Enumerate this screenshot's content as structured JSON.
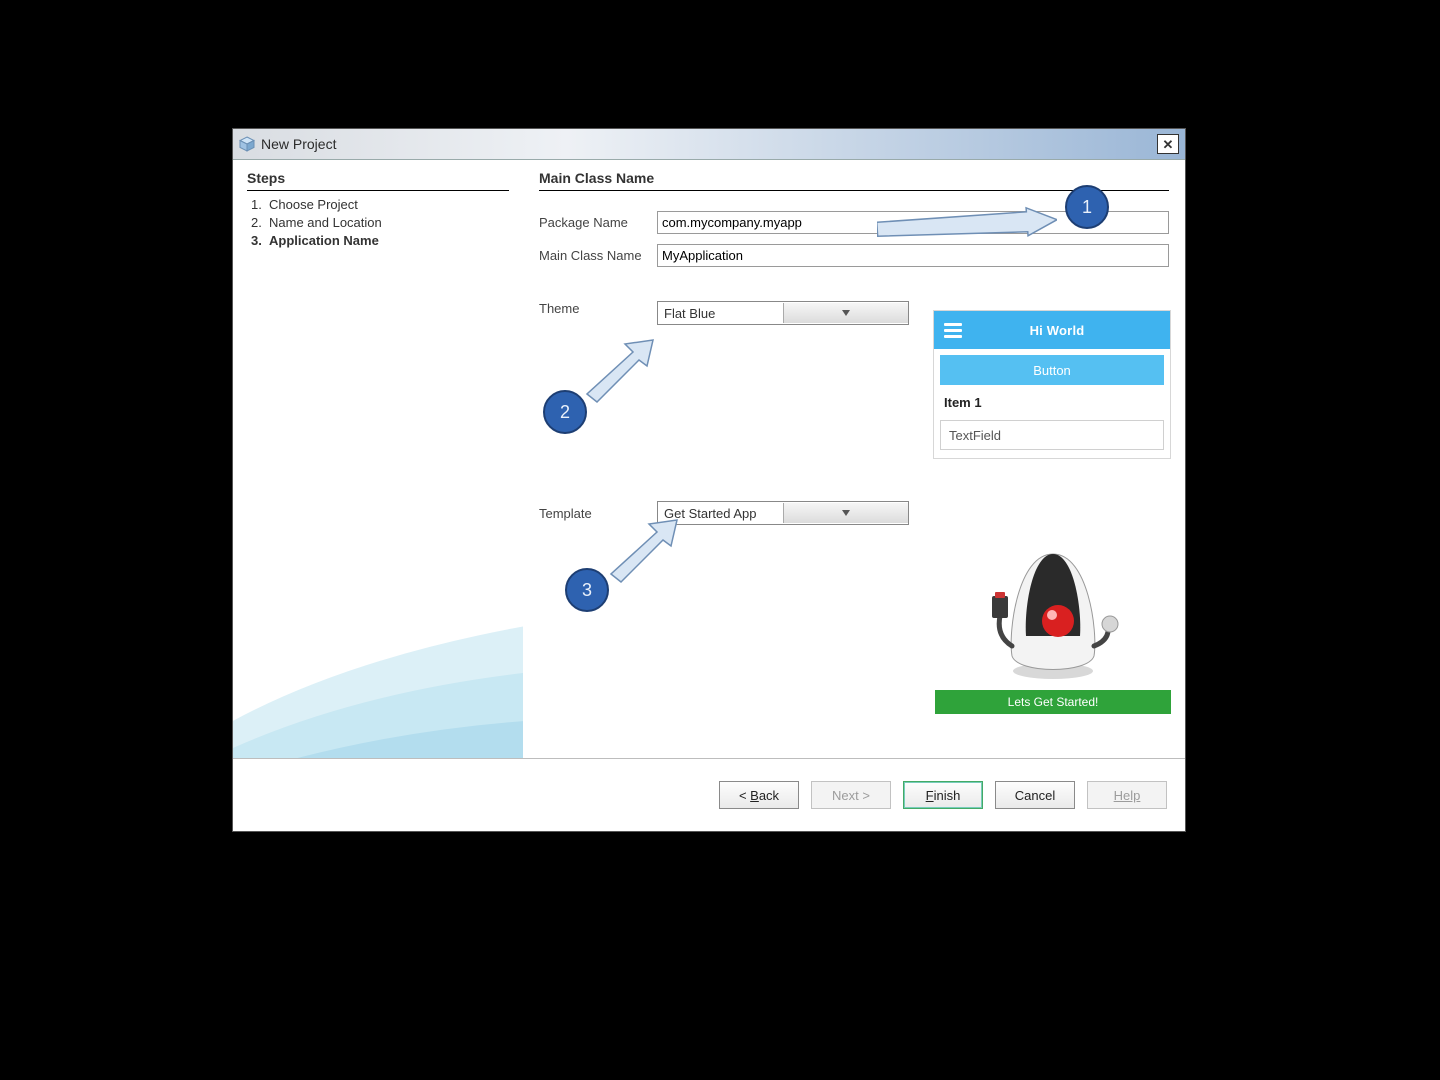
{
  "titlebar": {
    "title": "New Project"
  },
  "sidebar": {
    "heading": "Steps",
    "steps": [
      {
        "num": "1.",
        "label": "Choose Project",
        "active": false
      },
      {
        "num": "2.",
        "label": "Name and Location",
        "active": false
      },
      {
        "num": "3.",
        "label": "Application Name",
        "active": true
      }
    ]
  },
  "main": {
    "heading": "Main Class Name",
    "package_label": "Package Name",
    "package_value": "com.mycompany.myapp",
    "class_label": "Main Class Name",
    "class_value": "MyApplication",
    "theme_label": "Theme",
    "theme_value": "Flat Blue",
    "template_label": "Template",
    "template_value": "Get Started App"
  },
  "theme_preview": {
    "title": "Hi World",
    "button": "Button",
    "item": "Item 1",
    "textfield": "TextField"
  },
  "template_preview": {
    "cta": "Lets Get Started!"
  },
  "footer": {
    "back": "< Back",
    "next": "Next >",
    "finish": "Finish",
    "cancel": "Cancel",
    "help": "Help"
  },
  "callouts": {
    "c1": "1",
    "c2": "2",
    "c3": "3"
  }
}
